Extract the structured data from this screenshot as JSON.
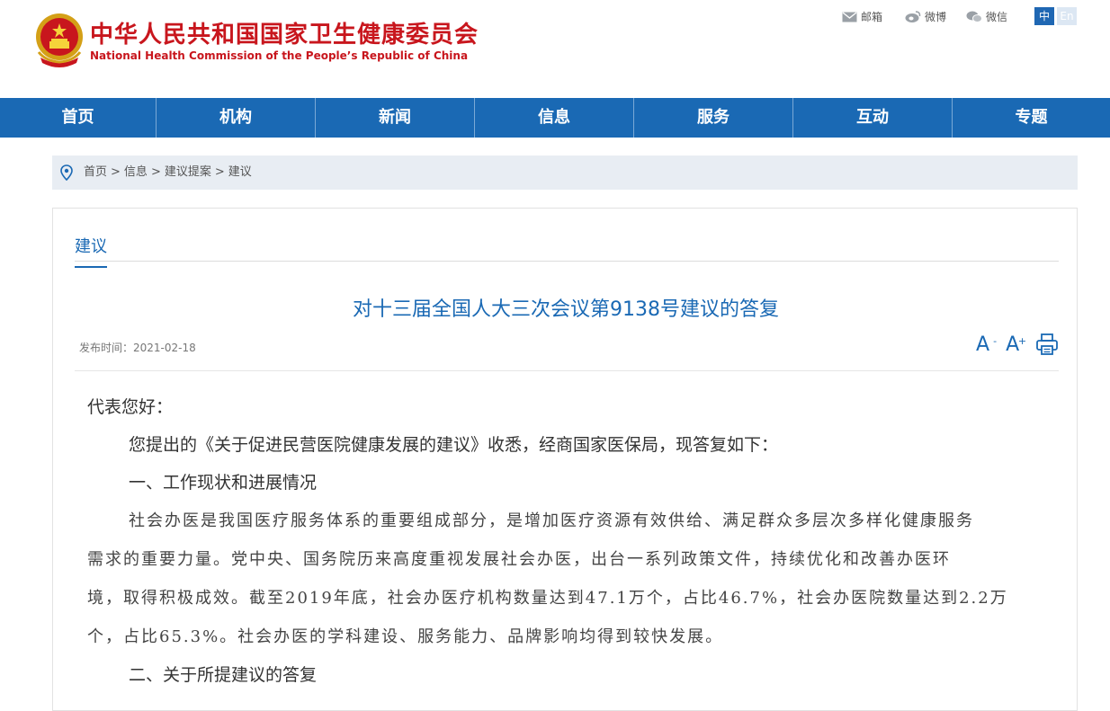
{
  "header": {
    "title_cn": "中华人民共和国国家卫生健康委员会",
    "title_en": "National Health Commission of the People’s Republic of China",
    "links": {
      "mail": "邮箱",
      "weibo": "微博",
      "wechat": "微信"
    },
    "lang": {
      "zh": "中",
      "en": "En"
    }
  },
  "nav": [
    "首页",
    "机构",
    "新闻",
    "信息",
    "服务",
    "互动",
    "专题"
  ],
  "breadcrumb": [
    "首页",
    "信息",
    "建议提案",
    "建议"
  ],
  "section": {
    "tab": "建议"
  },
  "article": {
    "title": "对十三届全国人大三次会议第9138号建议的答复",
    "date_label": "发布时间：",
    "date": "2021-02-18",
    "tools": {
      "font_decrease": "A",
      "font_decrease_sup": "-",
      "font_increase": "A",
      "font_increase_sup": "+"
    },
    "greeting": "代表您好：",
    "intro": "您提出的《关于促进民营医院健康发展的建议》收悉，经商国家医保局，现答复如下：",
    "heading1": "一、工作现状和进展情况",
    "para_lines": [
      "社会办医是我国医疗服务体系的重要组成部分，是增加医疗资源有效供给、满足群众多层次多样化健康服务",
      "需求的重要力量。党中央、国务院历来高度重视发展社会办医，出台一系列政策文件，持续优化和改善办医环",
      "境，取得积极成效。截至2019年底，社会办医疗机构数量达到47.1万个，占比46.7%，社会办医院数量达到2.2万",
      "个，占比65.3%。社会办医的学科建设、服务能力、品牌影响均得到较快发展。"
    ],
    "heading2": "二、关于所提建议的答复"
  },
  "colors": {
    "brand_red": "#c8161d",
    "nav_blue": "#1a69b4",
    "crumb_bg": "#e8edf3"
  }
}
